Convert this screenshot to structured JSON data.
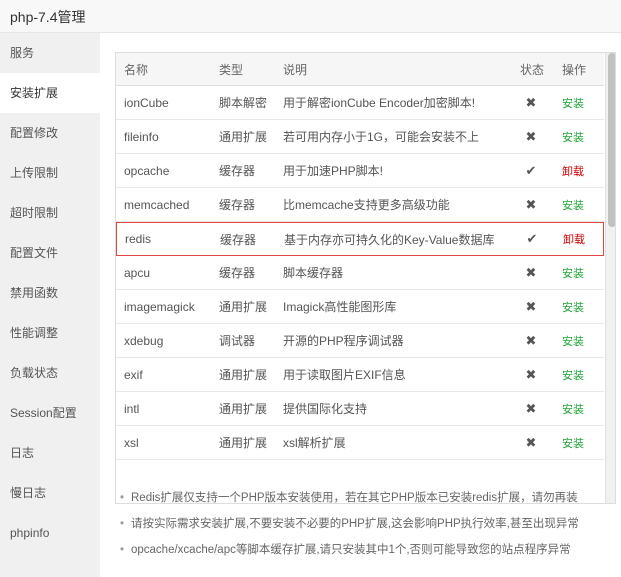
{
  "window": {
    "title": "php-7.4管理"
  },
  "sidebar": {
    "items": [
      {
        "label": "服务"
      },
      {
        "label": "安装扩展",
        "active": true
      },
      {
        "label": "配置修改"
      },
      {
        "label": "上传限制"
      },
      {
        "label": "超时限制"
      },
      {
        "label": "配置文件"
      },
      {
        "label": "禁用函数"
      },
      {
        "label": "性能调整"
      },
      {
        "label": "负载状态"
      },
      {
        "label": "Session配置"
      },
      {
        "label": "日志"
      },
      {
        "label": "慢日志"
      },
      {
        "label": "phpinfo"
      }
    ]
  },
  "table": {
    "headers": {
      "name": "名称",
      "type": "类型",
      "desc": "说明",
      "status": "状态",
      "action": "操作"
    },
    "rows": [
      {
        "name": "ionCube",
        "type": "脚本解密",
        "desc": "用于解密ionCube Encoder加密脚本!",
        "status": "✖",
        "action": "安装"
      },
      {
        "name": "fileinfo",
        "type": "通用扩展",
        "desc": "若可用内存小于1G，可能会安装不上",
        "status": "✖",
        "action": "安装"
      },
      {
        "name": "opcache",
        "type": "缓存器",
        "desc": "用于加速PHP脚本!",
        "status": "✔",
        "action": "卸载"
      },
      {
        "name": "memcached",
        "type": "缓存器",
        "desc": "比memcache支持更多高级功能",
        "status": "✖",
        "action": "安装"
      },
      {
        "name": "redis",
        "type": "缓存器",
        "desc": "基于内存亦可持久化的Key-Value数据库",
        "status": "✔",
        "action": "卸载"
      },
      {
        "name": "apcu",
        "type": "缓存器",
        "desc": "脚本缓存器",
        "status": "✖",
        "action": "安装"
      },
      {
        "name": "imagemagick",
        "type": "通用扩展",
        "desc": "Imagick高性能图形库",
        "status": "✖",
        "action": "安装"
      },
      {
        "name": "xdebug",
        "type": "调试器",
        "desc": "开源的PHP程序调试器",
        "status": "✖",
        "action": "安装"
      },
      {
        "name": "exif",
        "type": "通用扩展",
        "desc": "用于读取图片EXIF信息",
        "status": "✖",
        "action": "安装"
      },
      {
        "name": "intl",
        "type": "通用扩展",
        "desc": "提供国际化支持",
        "status": "✖",
        "action": "安装"
      },
      {
        "name": "xsl",
        "type": "通用扩展",
        "desc": "xsl解析扩展",
        "status": "✖",
        "action": "安装"
      }
    ]
  },
  "notes": [
    "Redis扩展仅支持一个PHP版本安装使用，若在其它PHP版本已安装redis扩展，请勿再装",
    "请按实际需求安装扩展,不要安装不必要的PHP扩展,这会影响PHP执行效率,甚至出现异常",
    "opcache/xcache/apc等脚本缓存扩展,请只安装其中1个,否则可能导致您的站点程序异常"
  ],
  "colors": {
    "install": "#20a53a",
    "uninstall": "#cc0000",
    "highlight_border": "#e04444"
  }
}
